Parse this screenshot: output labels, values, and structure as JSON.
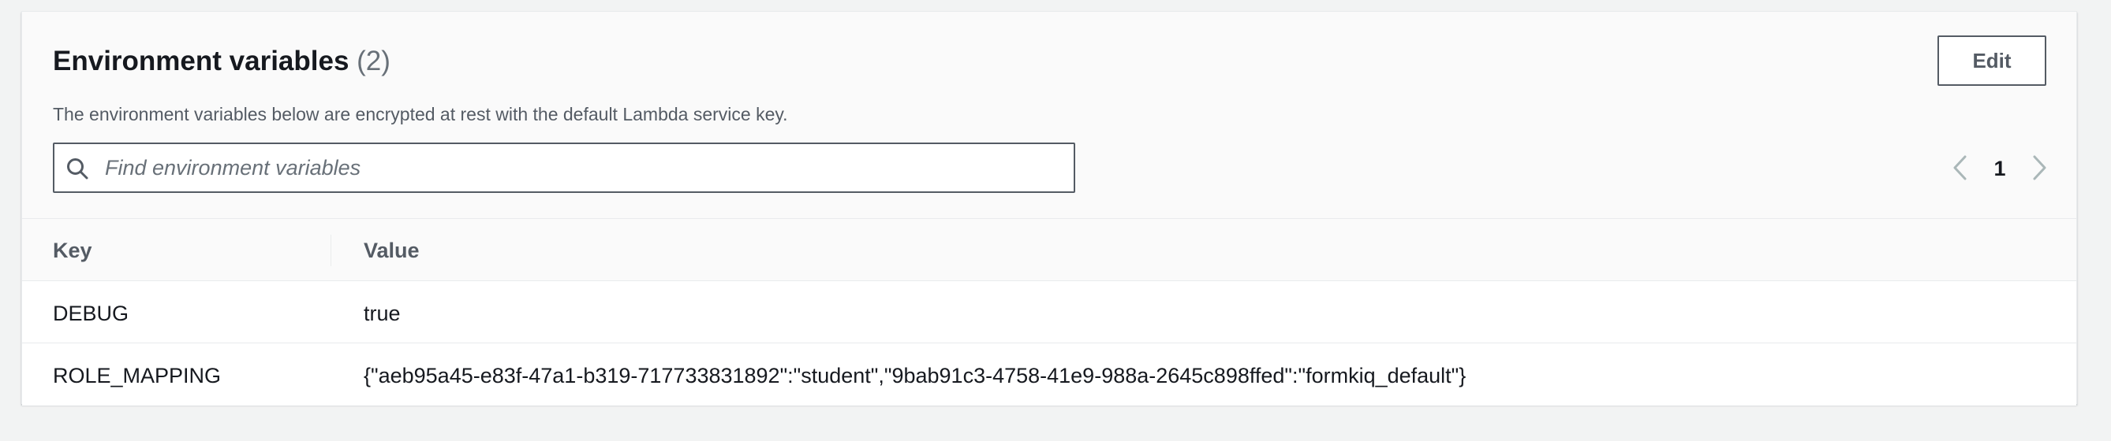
{
  "section": {
    "title": "Environment variables",
    "count": "(2)",
    "description": "The environment variables below are encrypted at rest with the default Lambda service key.",
    "edit_label": "Edit"
  },
  "search": {
    "placeholder": "Find environment variables",
    "value": ""
  },
  "pagination": {
    "current_page": "1",
    "prev_icon": "chevron-left-icon",
    "next_icon": "chevron-right-icon"
  },
  "table": {
    "columns": [
      "Key",
      "Value"
    ],
    "rows": [
      {
        "key": "DEBUG",
        "value": "true"
      },
      {
        "key": "ROLE_MAPPING",
        "value": "{\"aeb95a45-e83f-47a1-b319-717733831892\":\"student\",\"9bab91c3-4758-41e9-988a-2645c898ffed\":\"formkiq_default\"}"
      }
    ]
  },
  "colors": {
    "text_primary": "#16191f",
    "text_secondary": "#545b64",
    "text_muted": "#687078",
    "border": "#545b64",
    "divider": "#e9ebed",
    "panel_bg": "#fafafa",
    "page_bg": "#f2f3f3"
  }
}
